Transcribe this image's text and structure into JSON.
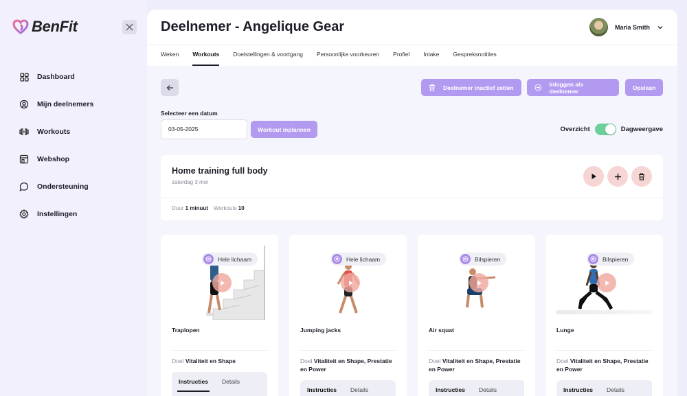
{
  "brand": {
    "name": "BenFit",
    "accent": "#b39af1"
  },
  "sidebar": {
    "items": [
      {
        "label": "Dashboard",
        "icon": "grid-icon"
      },
      {
        "label": "Mijn deelnemers",
        "icon": "people-icon"
      },
      {
        "label": "Workouts",
        "icon": "dumbbell-icon"
      },
      {
        "label": "Webshop",
        "icon": "store-icon"
      },
      {
        "label": "Ondersteuning",
        "icon": "chat-icon"
      },
      {
        "label": "Instellingen",
        "icon": "gear-icon"
      }
    ]
  },
  "header": {
    "title": "Deelnemer - Angelique Gear",
    "user_name": "Maria Smith"
  },
  "tabs": [
    {
      "label": "Weken"
    },
    {
      "label": "Workouts",
      "active": true
    },
    {
      "label": "Doelstellingen & voortgang"
    },
    {
      "label": "Persoonlijke voorkeuren"
    },
    {
      "label": "Profiel"
    },
    {
      "label": "Intake"
    },
    {
      "label": "Gespreksnotities"
    }
  ],
  "actions": {
    "deactivate": "Deelnemer inactief zetten",
    "login_as": "Inloggen als deelnemer",
    "save": "Opslaan"
  },
  "date_picker": {
    "label": "Selecteer een datum",
    "value": "03-05-2025",
    "plan_button": "Workout inplannen"
  },
  "view_toggle": {
    "left_label": "Overzicht",
    "right_label": "Dagweergave",
    "on": true,
    "on_color": "#6ccf9c"
  },
  "workout": {
    "title": "Home training full body",
    "date": "zaterdag 3 mei",
    "duration_label": "Duur",
    "duration_value": "1 minuut",
    "count_label": "Workouts",
    "count_value": "10"
  },
  "exercises": [
    {
      "name": "Traplopen",
      "badge": "Hele lichaam",
      "goal_label": "Doel",
      "goal": "Vitaliteit en Shape",
      "tab_instructions": "Instructies",
      "tab_details": "Details"
    },
    {
      "name": "Jumping jacks",
      "badge": "Hele lichaam",
      "goal_label": "Doel",
      "goal": "Vitaliteit en Shape, Prestatie en Power",
      "tab_instructions": "Instructies",
      "tab_details": "Details"
    },
    {
      "name": "Air squat",
      "badge": "Bilspieren",
      "goal_label": "Doel",
      "goal": "Vitaliteit en Shape, Prestatie en Power",
      "tab_instructions": "Instructies",
      "tab_details": "Details"
    },
    {
      "name": "Lunge",
      "badge": "Bilspieren",
      "goal_label": "Doel",
      "goal": "Vitaliteit en Shape, Prestatie en Power",
      "tab_instructions": "Instructies",
      "tab_details": "Details"
    }
  ]
}
